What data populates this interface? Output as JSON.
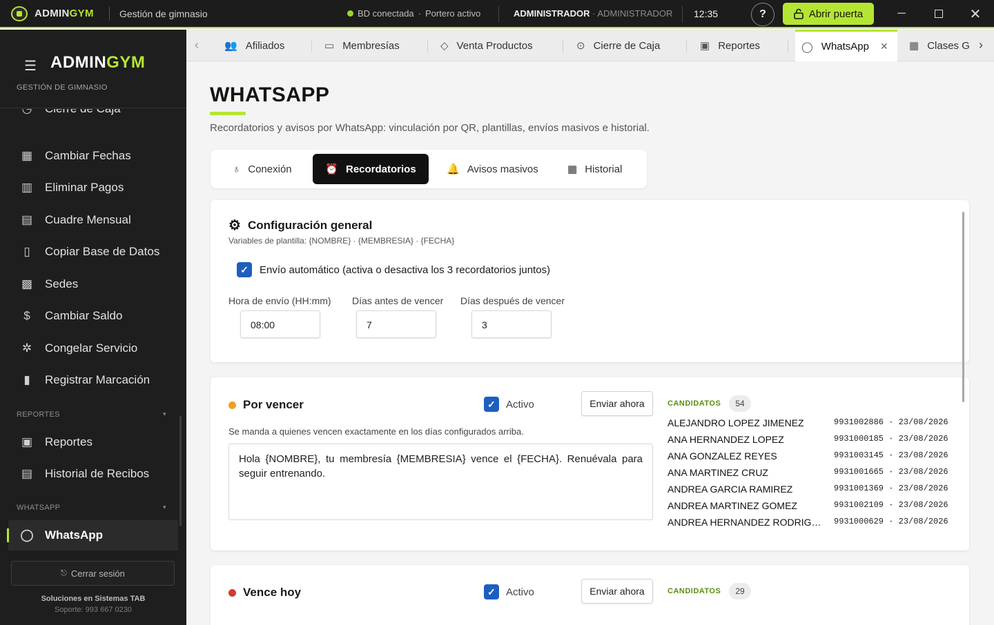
{
  "titlebar": {
    "brand_prefix": "ADMIN",
    "brand_suffix": "GYM",
    "subtitle": "Gestión de gimnasio",
    "db_status": "BD conectada",
    "status_separator": "·",
    "door_status": "Portero activo",
    "user": "ADMINISTRADOR",
    "role": "· ADMINISTRADOR",
    "time": "12:35",
    "help": "?",
    "open_door": "Abrir puerta",
    "accent_color": "#b5e533"
  },
  "sidebar": {
    "brand_prefix": "ADMIN",
    "brand_suffix": "GYM",
    "subtitle": "GESTIÓN DE GIMNASIO",
    "items": [
      {
        "label": "Cierre de Caja",
        "icon": "cash-register-icon"
      },
      {
        "label": "Cambiar Fechas",
        "icon": "calendar-icon"
      },
      {
        "label": "Eliminar Pagos",
        "icon": "trash-icon"
      },
      {
        "label": "Cuadre Mensual",
        "icon": "calculator-icon"
      },
      {
        "label": "Copiar Base de Datos",
        "icon": "database-icon"
      },
      {
        "label": "Sedes",
        "icon": "building-icon"
      },
      {
        "label": "Cambiar Saldo",
        "icon": "dollar-icon"
      },
      {
        "label": "Congelar Servicio",
        "icon": "snowflake-icon"
      },
      {
        "label": "Registrar Marcación",
        "icon": "phone-icon"
      }
    ],
    "section_reports": "REPORTES",
    "report_items": [
      {
        "label": "Reportes",
        "icon": "chart-icon"
      },
      {
        "label": "Historial de Recibos",
        "icon": "receipt-icon"
      }
    ],
    "section_whatsapp": "WHATSAPP",
    "whatsapp_item": {
      "label": "WhatsApp",
      "icon": "chat-bubble-icon"
    },
    "logout": "Cerrar sesión",
    "footer_company": "Soluciones en Sistemas TAB",
    "footer_support": "Soporte: 993 667 0230"
  },
  "tabs": [
    {
      "label": "Afiliados",
      "icon": "users-icon"
    },
    {
      "label": "Membresías",
      "icon": "card-icon"
    },
    {
      "label": "Venta Productos",
      "icon": "tag-icon"
    },
    {
      "label": "Cierre de Caja",
      "icon": "money-bag-icon"
    },
    {
      "label": "Reportes",
      "icon": "chart-icon"
    },
    {
      "label": "WhatsApp",
      "icon": "chat-bubble-icon",
      "active": true
    },
    {
      "label": "Clases G",
      "icon": "calendar-icon"
    }
  ],
  "page": {
    "title": "WHATSAPP",
    "description": "Recordatorios y avisos por WhatsApp: vinculación por QR, plantillas, envíos masivos e historial.",
    "subtabs": [
      {
        "label": "Conexión",
        "icon": "plug-icon"
      },
      {
        "label": "Recordatorios",
        "icon": "alarm-clock-icon",
        "active": true
      },
      {
        "label": "Avisos masivos",
        "icon": "bell-icon"
      },
      {
        "label": "Historial",
        "icon": "calendar-icon"
      }
    ]
  },
  "config": {
    "title": "Configuración general",
    "vars": "Variables de plantilla: {NOMBRE} · {MEMBRESIA} · {FECHA}",
    "auto_label": "Envío automático (activa o desactiva los 3 recordatorios juntos)",
    "auto_checked": true,
    "hour_label": "Hora de envío (HH:mm)",
    "hour_value": "08:00",
    "before_label": "Días antes de vencer",
    "before_value": "7",
    "after_label": "Días después de vencer",
    "after_value": "3"
  },
  "reminders": [
    {
      "title": "Por vencer",
      "dot_color": "#f0a020",
      "active_label": "Activo",
      "active": true,
      "send_label": "Enviar ahora",
      "note": "Se manda a quienes vencen exactamente en los días configurados arriba.",
      "template": "Hola {NOMBRE}, tu membresía {MEMBRESIA} vence el {FECHA}. Renuévala para seguir entrenando.",
      "candidates_label": "CANDIDATOS",
      "candidates_count": "54",
      "candidates": [
        {
          "name": "ALEJANDRO LOPEZ JIMENEZ",
          "meta": "9931002886 · 23/08/2026"
        },
        {
          "name": "ANA HERNANDEZ LOPEZ",
          "meta": "9931000185 · 23/08/2026"
        },
        {
          "name": "ANA GONZALEZ REYES",
          "meta": "9931003145 · 23/08/2026"
        },
        {
          "name": "ANA MARTINEZ CRUZ",
          "meta": "9931001665 · 23/08/2026"
        },
        {
          "name": "ANDREA GARCIA RAMIREZ",
          "meta": "9931001369 · 23/08/2026"
        },
        {
          "name": "ANDREA MARTINEZ GOMEZ",
          "meta": "9931002109 · 23/08/2026"
        },
        {
          "name": "ANDREA HERNANDEZ RODRIGUEZ",
          "meta": "9931000629 · 23/08/2026"
        }
      ]
    },
    {
      "title": "Vence hoy",
      "dot_color": "#d23b2e",
      "active_label": "Activo",
      "active": true,
      "send_label": "Enviar ahora",
      "candidates_label": "CANDIDATOS",
      "candidates_count": "29"
    }
  ]
}
